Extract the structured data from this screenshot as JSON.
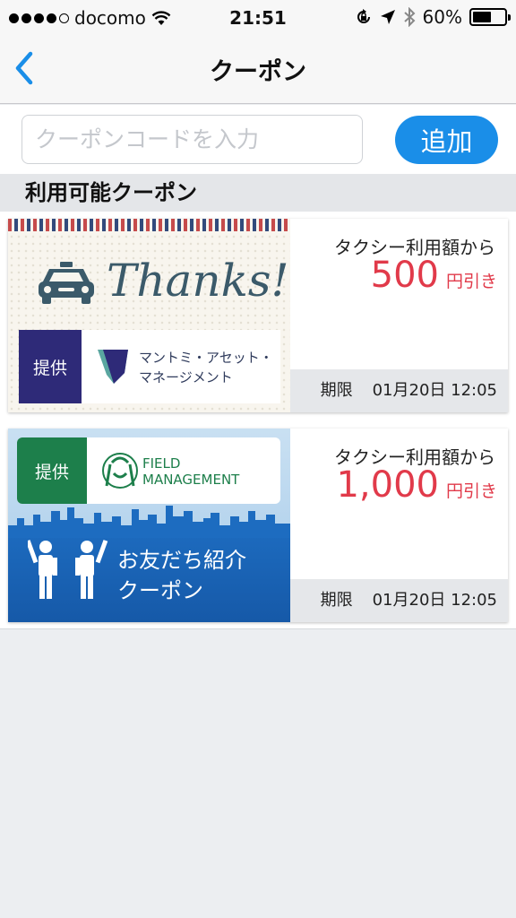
{
  "status_bar": {
    "carrier": "docomo",
    "time": "21:51",
    "battery_text": "60%",
    "battery_level": 0.6
  },
  "nav": {
    "title": "クーポン",
    "back_icon": "chevron-left-icon"
  },
  "search": {
    "placeholder": "クーポンコードを入力",
    "value": "",
    "add_label": "追加"
  },
  "section": {
    "title": "利用可能クーポン"
  },
  "coupons": [
    {
      "banner_text": "Thanks!",
      "sponsor_tag": "提供",
      "sponsor_name": "マントミ・アセット・\nマネージメント",
      "condition": "タクシー利用額から",
      "amount": "500",
      "unit": "円引き",
      "expiry_label": "期限",
      "expiry_value": "01月20日 12:05"
    },
    {
      "sponsor_tag": "提供",
      "sponsor_name": "FIELD\nMANAGEMENT",
      "banner_caption": "お友だち紹介\nクーポン",
      "condition": "タクシー利用額から",
      "amount": "1,000",
      "unit": "円引き",
      "expiry_label": "期限",
      "expiry_value": "01月20日 12:05"
    }
  ],
  "colors": {
    "accent": "#1a8ee8",
    "discount": "#e13a4a",
    "sponsor1": "#2e2a78",
    "sponsor2": "#1d7f4b"
  }
}
